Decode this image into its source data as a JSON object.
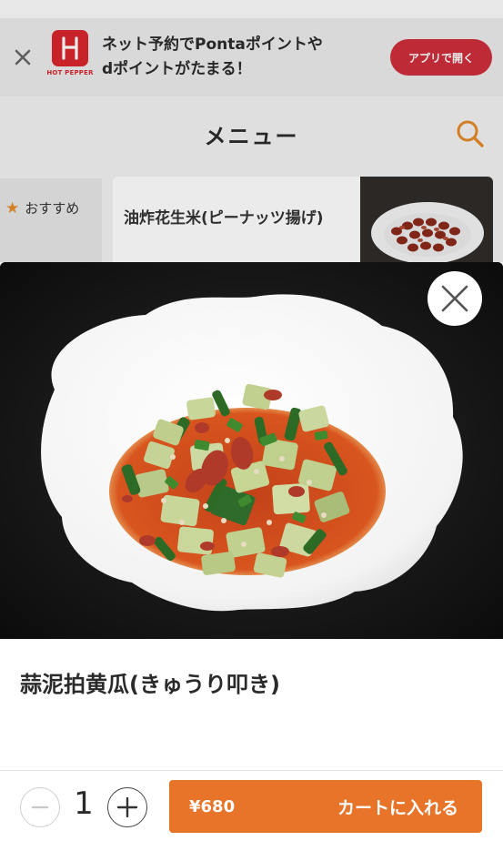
{
  "banner": {
    "logo_text": "HOT PEPPER",
    "message_line1": "ネット予約でPontaポイントや",
    "message_line2": "dポイントがたまる！",
    "open_app_label": "アプリで開く",
    "close_icon": "close-icon",
    "brand_color": "#d9262d"
  },
  "header": {
    "title": "メニュー",
    "search_icon": "search-icon",
    "accent": "#e58a2a"
  },
  "sidebar": {
    "items": [
      {
        "label": "おすすめ",
        "icon": "star-icon"
      }
    ]
  },
  "list": {
    "items": [
      {
        "name": "油炸花生米(ピーナッツ揚げ)"
      }
    ]
  },
  "modal": {
    "close_icon": "close-icon",
    "item_name": "蒜泥拍黄瓜(きゅうり叩き)",
    "quantity": "1",
    "minus_icon": "minus-icon",
    "plus_icon": "plus-icon",
    "price": "¥680",
    "add_to_cart_label": "カートに入れる",
    "button_color": "#e8742a"
  }
}
